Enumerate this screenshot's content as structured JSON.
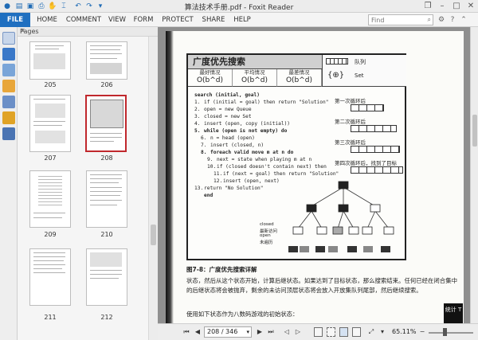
{
  "window": {
    "title": "算法技术手册.pdf - Foxit Reader",
    "buttons": {
      "restore": "❐",
      "minimize": "–",
      "maximize": "□",
      "close": "✕"
    }
  },
  "ribbon": {
    "tabs": [
      "FILE",
      "HOME",
      "COMMENT",
      "VIEW",
      "FORM",
      "PROTECT",
      "SHARE",
      "HELP"
    ],
    "search_placeholder": "Find",
    "search_icon": "search-icon"
  },
  "pages_panel": {
    "title": "Pages",
    "thumbnails": [
      {
        "label": "205",
        "selected": false
      },
      {
        "label": "206",
        "selected": false
      },
      {
        "label": "207",
        "selected": false
      },
      {
        "label": "208",
        "selected": true
      },
      {
        "label": "209",
        "selected": false
      },
      {
        "label": "210",
        "selected": false
      },
      {
        "label": "211",
        "selected": false
      },
      {
        "label": "212",
        "selected": false
      }
    ]
  },
  "document": {
    "algo_title": "广度优先搜索",
    "complexity": [
      {
        "heading": "最好情况",
        "value": "O(b^d)"
      },
      {
        "heading": "平均情况",
        "value": "O(b^d)"
      },
      {
        "heading": "最差情况",
        "value": "O(b^d)"
      }
    ],
    "legend": {
      "queue": "队列",
      "set": "Set"
    },
    "code_header": "search (initial, goal)",
    "code": [
      {
        "n": "1.",
        "t": "if (initial = goal) then return \"Solution\""
      },
      {
        "n": "2.",
        "t": "open = new Queue"
      },
      {
        "n": "3.",
        "t": "closed = new Set"
      },
      {
        "n": "4.",
        "t": "insert (open, copy (initial))"
      },
      {
        "n": "5.",
        "t": "while (open is not empty) do"
      },
      {
        "n": "6.",
        "t": "n = head (open)"
      },
      {
        "n": "7.",
        "t": "insert (closed, n)"
      },
      {
        "n": "8.",
        "t": "foreach valid move m at n do"
      },
      {
        "n": "9.",
        "t": "next = state when playing m at n"
      },
      {
        "n": "10.",
        "t": "if (closed doesn't contain next) then"
      },
      {
        "n": "11.",
        "t": "if (next = goal) then return \"Solution\""
      },
      {
        "n": "12.",
        "t": "insert (open, next)"
      },
      {
        "n": "13.",
        "t": "return \"No Solution\""
      },
      {
        "n": "",
        "t": "end"
      }
    ],
    "side_notes": [
      "第一次循环后",
      "第二次循环后",
      "第三次循环后",
      "第四次循环后，找到了目标"
    ],
    "tree_legend": [
      "closed",
      "最新访问",
      "open",
      "未遍历"
    ],
    "caption": "图7-8：广度优先搜索详解",
    "paragraph1": "状态，然后从这个状态开始，计算后继状态。如果达到了目标状态，那么搜索结束。任何已经在闭合集中的后继状态将会被抛弃，剩余的未访问顶层状态将会放入开放集队列尾部，然后继续搜索。",
    "paragraph2": "使用如下状态作为八数码游戏的初始状态："
  },
  "statusbar": {
    "page_value": "208 / 346",
    "zoom": "65.11%"
  },
  "stamp": {
    "text": "统计\nT"
  }
}
